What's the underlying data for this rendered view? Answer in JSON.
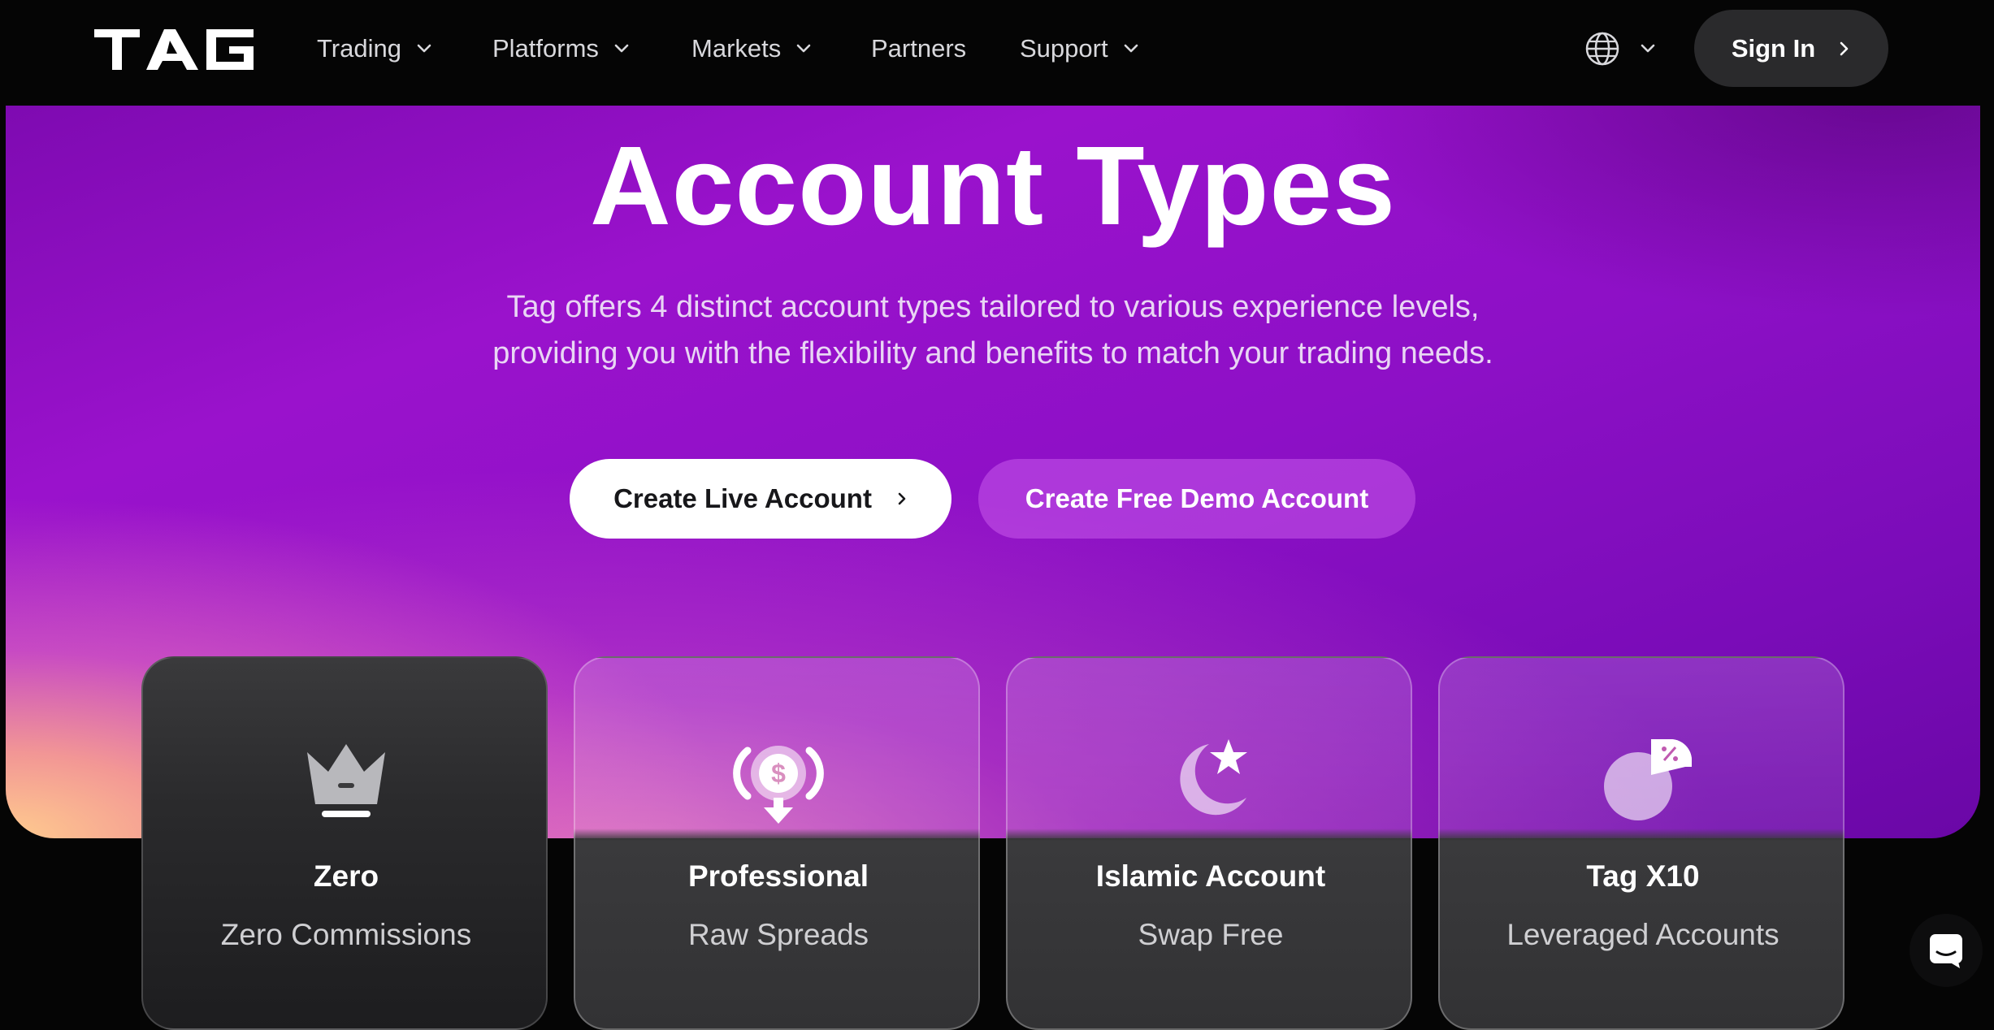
{
  "nav": {
    "logo_alt": "TAG",
    "items": [
      {
        "label": "Trading",
        "dropdown": true
      },
      {
        "label": "Platforms",
        "dropdown": true
      },
      {
        "label": "Markets",
        "dropdown": true
      },
      {
        "label": "Partners",
        "dropdown": false
      },
      {
        "label": "Support",
        "dropdown": true
      }
    ],
    "language_icon": "globe-icon",
    "signin_label": "Sign In"
  },
  "hero": {
    "title": "Account Types",
    "subtitle": "Tag offers 4 distinct account types tailored to various experience levels, providing you with the flexibility and benefits to match your trading needs.",
    "primary_button": "Create Live Account",
    "secondary_button": "Create Free Demo Account"
  },
  "cards": [
    {
      "name": "Zero",
      "desc": "Zero Commissions",
      "icon": "crown-icon",
      "active": true
    },
    {
      "name": "Professional",
      "desc": "Raw Spreads",
      "icon": "dollar-coin-icon",
      "active": false
    },
    {
      "name": "Islamic Account",
      "desc": "Swap Free",
      "icon": "moon-star-icon",
      "active": false
    },
    {
      "name": "Tag X10",
      "desc": "Leveraged Accounts",
      "icon": "pie-percent-icon",
      "active": false
    }
  ],
  "chat_icon": "chat-icon",
  "colors": {
    "nav_bg": "#050505",
    "hero_purple": "#9a12cc",
    "hero_peach": "#ffcc8e",
    "card_dark": "#2a2a2c",
    "signin_bg": "#2a2a2c"
  }
}
